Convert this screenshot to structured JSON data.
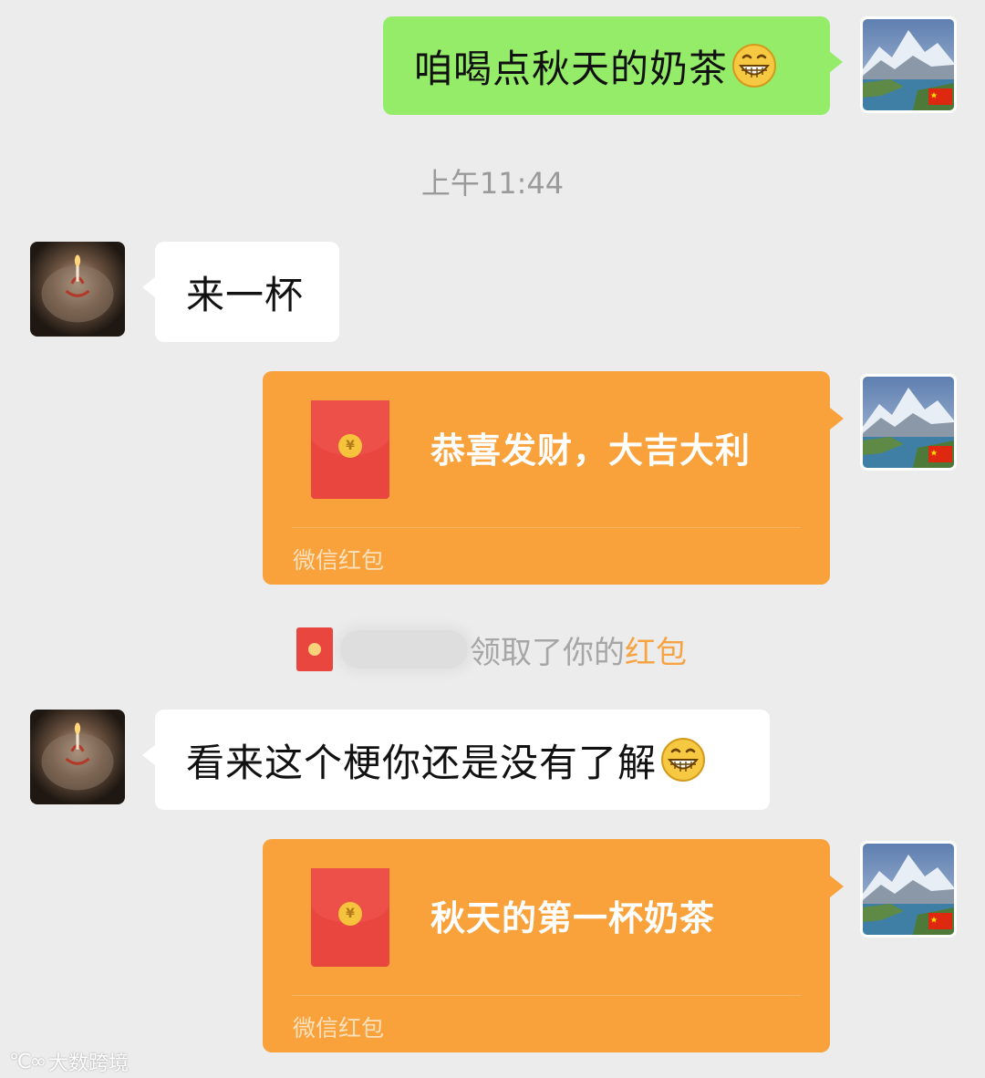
{
  "messages": [
    {
      "sender": "me",
      "text": "咱喝点秋天的奶茶",
      "emoji": "grinning-emoji"
    },
    {
      "timestamp": "上午11:44"
    },
    {
      "sender": "friend",
      "text": "来一杯"
    },
    {
      "sender": "me",
      "type": "red-packet",
      "title": "恭喜发财，大吉大利",
      "label": "微信红包"
    },
    {
      "notice": {
        "suffix": "领取了你的",
        "link": "红包"
      }
    },
    {
      "sender": "friend",
      "text": "看来这个梗你还是没有了解",
      "emoji": "grinning-emoji"
    },
    {
      "sender": "me",
      "type": "red-packet",
      "title": "秋天的第一杯奶茶",
      "label": "微信红包"
    }
  ],
  "watermark": {
    "logo": "℃∞",
    "text": "大数跨境"
  },
  "colors": {
    "background": "#ececec",
    "my_bubble": "#95ec69",
    "friend_bubble": "#ffffff",
    "red_packet": "#f9a23b",
    "envelope": "#e8463f",
    "notice_link": "#f6a443"
  }
}
